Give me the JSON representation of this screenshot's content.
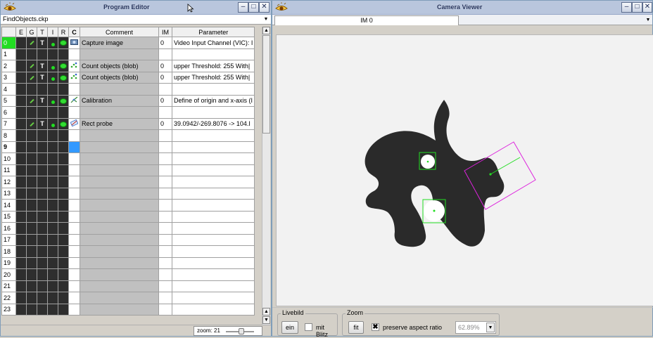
{
  "program_editor": {
    "title": "Program Editor",
    "file_name": "FindObjects.ckp",
    "columns": [
      "E",
      "G",
      "T",
      "I",
      "R",
      "C",
      "Comment",
      "IM",
      "Parameter"
    ],
    "rows": [
      {
        "num": "0",
        "comment": "Capture image",
        "im": "0",
        "param": "Video Input Channel (VIC): I",
        "icon": "camera-icon",
        "tools": true
      },
      {
        "num": "1",
        "comment": "",
        "im": "",
        "param": "",
        "icon": "",
        "tools": false
      },
      {
        "num": "2",
        "comment": "Count objects (blob)",
        "im": "0",
        "param": "upper Threshold: 255 With|",
        "icon": "blob-icon",
        "tools": true
      },
      {
        "num": "3",
        "comment": "Count objects (blob)",
        "im": "0",
        "param": "upper Threshold: 255 With|",
        "icon": "blob-icon",
        "tools": true
      },
      {
        "num": "4",
        "comment": "",
        "im": "",
        "param": "",
        "icon": "",
        "tools": false
      },
      {
        "num": "5",
        "comment": "Calibration",
        "im": "0",
        "param": "Define of origin and x-axis (I",
        "icon": "calibration-icon",
        "tools": true
      },
      {
        "num": "6",
        "comment": "",
        "im": "",
        "param": "",
        "icon": "",
        "tools": false
      },
      {
        "num": "7",
        "comment": "Rect probe",
        "im": "0",
        "param": "39.0942/-269.8076 -> 104.I",
        "icon": "probe-icon",
        "tools": true
      },
      {
        "num": "8",
        "comment": "",
        "im": "",
        "param": "",
        "icon": "",
        "tools": false
      },
      {
        "num": "9",
        "comment": "",
        "im": "",
        "param": "",
        "icon": "",
        "tools": false
      },
      {
        "num": "10",
        "comment": "",
        "im": "",
        "param": "",
        "icon": "",
        "tools": false
      },
      {
        "num": "11",
        "comment": "",
        "im": "",
        "param": "",
        "icon": "",
        "tools": false
      },
      {
        "num": "12",
        "comment": "",
        "im": "",
        "param": "",
        "icon": "",
        "tools": false
      },
      {
        "num": "13",
        "comment": "",
        "im": "",
        "param": "",
        "icon": "",
        "tools": false
      },
      {
        "num": "14",
        "comment": "",
        "im": "",
        "param": "",
        "icon": "",
        "tools": false
      },
      {
        "num": "15",
        "comment": "",
        "im": "",
        "param": "",
        "icon": "",
        "tools": false
      },
      {
        "num": "16",
        "comment": "",
        "im": "",
        "param": "",
        "icon": "",
        "tools": false
      },
      {
        "num": "17",
        "comment": "",
        "im": "",
        "param": "",
        "icon": "",
        "tools": false
      },
      {
        "num": "18",
        "comment": "",
        "im": "",
        "param": "",
        "icon": "",
        "tools": false
      },
      {
        "num": "19",
        "comment": "",
        "im": "",
        "param": "",
        "icon": "",
        "tools": false
      },
      {
        "num": "20",
        "comment": "",
        "im": "",
        "param": "",
        "icon": "",
        "tools": false
      },
      {
        "num": "21",
        "comment": "",
        "im": "",
        "param": "",
        "icon": "",
        "tools": false
      },
      {
        "num": "22",
        "comment": "",
        "im": "",
        "param": "",
        "icon": "",
        "tools": false
      },
      {
        "num": "23",
        "comment": "",
        "im": "",
        "param": "",
        "icon": "",
        "tools": false
      }
    ],
    "active_row": "0",
    "selected_row": "9",
    "zoom_label": "zoom: 21"
  },
  "camera_viewer": {
    "title": "Camera Viewer",
    "tab_label": "IM 0",
    "livebild": {
      "legend": "Livebild",
      "button": "ein",
      "checkbox_label": "mit Blitz",
      "checked": false
    },
    "zoom": {
      "legend": "Zoom",
      "fit_button": "fit",
      "checkbox_label": "preserve aspect ratio",
      "checked": true,
      "value": "62.89%"
    }
  },
  "colors": {
    "active_row": "#22dd22",
    "selected_cell": "#3399ff",
    "dark_cell": "#2e2e2e",
    "overlay_green": "#22dd22",
    "overlay_magenta": "#dd22dd"
  }
}
